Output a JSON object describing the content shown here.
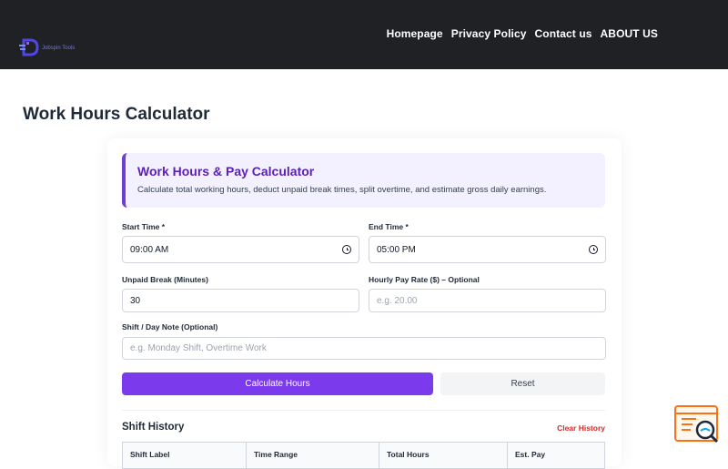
{
  "nav": {
    "logo_text": "Jobspin Tools",
    "items": [
      "Homepage",
      "Privacy Policy",
      "Contact us",
      "ABOUT US"
    ]
  },
  "page_title": "Work Hours Calculator",
  "intro": {
    "title": "Work Hours & Pay Calculator",
    "description": "Calculate total working hours, deduct unpaid break times, split overtime, and estimate gross daily earnings."
  },
  "form": {
    "start_time": {
      "label": "Start Time *",
      "value": "09:00 AM"
    },
    "end_time": {
      "label": "End Time *",
      "value": "05:00 PM"
    },
    "unpaid_break": {
      "label": "Unpaid Break (Minutes)",
      "value": "30"
    },
    "hourly_rate": {
      "label": "Hourly Pay Rate ($) – Optional",
      "placeholder": "e.g. 20.00"
    },
    "shift_note": {
      "label": "Shift / Day Note (Optional)",
      "placeholder": "e.g. Monday Shift, Overtime Work"
    }
  },
  "buttons": {
    "calculate": "Calculate Hours",
    "reset": "Reset"
  },
  "history": {
    "title": "Shift History",
    "clear": "Clear History",
    "columns": [
      "Shift Label",
      "Time Range",
      "Total Hours",
      "Est. Pay"
    ]
  },
  "colors": {
    "accent": "#7c3aed",
    "header_bg": "#202124",
    "danger": "#dc2626"
  },
  "icons": {
    "logo": "logo-icon",
    "clock": "clock-icon",
    "widget": "search-code-icon"
  }
}
